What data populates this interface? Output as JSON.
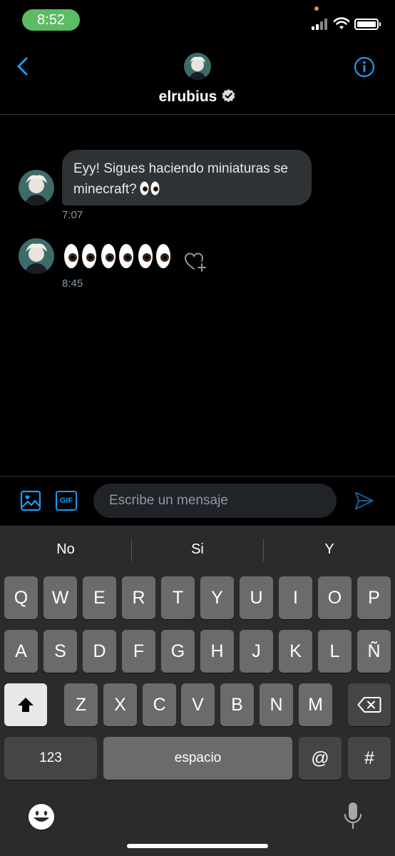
{
  "status_bar": {
    "time": "8:52"
  },
  "header": {
    "name": "elrubius"
  },
  "messages": [
    {
      "text": "Eyy! Sigues haciendo miniaturas se minecraft?",
      "time": "7:07"
    },
    {
      "time": "8:45"
    }
  ],
  "composer": {
    "placeholder": "Escribe un mensaje",
    "gif_label": "GIF"
  },
  "keyboard": {
    "suggestions": [
      "No",
      "Si",
      "Y"
    ],
    "row1": [
      "Q",
      "W",
      "E",
      "R",
      "T",
      "Y",
      "U",
      "I",
      "O",
      "P"
    ],
    "row2": [
      "A",
      "S",
      "D",
      "F",
      "G",
      "H",
      "J",
      "K",
      "L",
      "Ñ"
    ],
    "row3": [
      "Z",
      "X",
      "C",
      "V",
      "B",
      "N",
      "M"
    ],
    "numbers_label": "123",
    "space_label": "espacio",
    "at_label": "@",
    "hash_label": "#"
  },
  "colors": {
    "accent": "#1d9bf0",
    "bubble": "#2f3336",
    "status_pill": "#5dbb63",
    "keyboard_bg": "#2b2b2d",
    "key": "#6b6b6e"
  }
}
